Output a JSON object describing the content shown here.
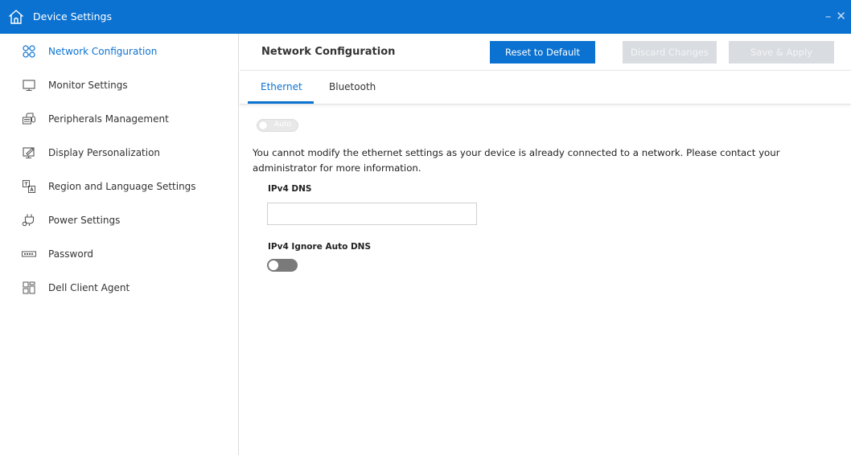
{
  "window": {
    "title": "Device Settings",
    "minimize_glyph": "–",
    "close_glyph": "✕"
  },
  "sidebar": {
    "items": [
      {
        "label": "Network Configuration",
        "icon": "network-icon",
        "active": true
      },
      {
        "label": "Monitor Settings",
        "icon": "monitor-icon",
        "active": false
      },
      {
        "label": "Peripherals Management",
        "icon": "peripherals-icon",
        "active": false
      },
      {
        "label": "Display Personalization",
        "icon": "display-personalization-icon",
        "active": false
      },
      {
        "label": "Region and Language Settings",
        "icon": "language-icon",
        "active": false
      },
      {
        "label": "Power Settings",
        "icon": "power-plug-icon",
        "active": false
      },
      {
        "label": "Password",
        "icon": "password-icon",
        "active": false
      },
      {
        "label": "Dell Client Agent",
        "icon": "apps-grid-icon",
        "active": false
      }
    ]
  },
  "header": {
    "title": "Network Configuration",
    "reset_label": "Reset to Default",
    "discard_label": "Discard Changes",
    "save_label": "Save & Apply"
  },
  "tabs": [
    {
      "label": "Ethernet",
      "active": true
    },
    {
      "label": "Bluetooth",
      "active": false
    }
  ],
  "content": {
    "auto_toggle_label": "Auto",
    "notice": "You cannot modify the ethernet settings as your device is already connected to a network. Please contact your administrator for more information.",
    "ipv4_dns_label": "IPv4 DNS",
    "ipv4_dns_value": "",
    "ipv4_ignore_auto_dns_label": "IPv4 Ignore Auto DNS",
    "ipv4_ignore_auto_dns_on": false
  },
  "colors": {
    "accent": "#0b72d1",
    "disabled_button": "#d9dce0",
    "toggle_off": "#7a7a7a"
  }
}
